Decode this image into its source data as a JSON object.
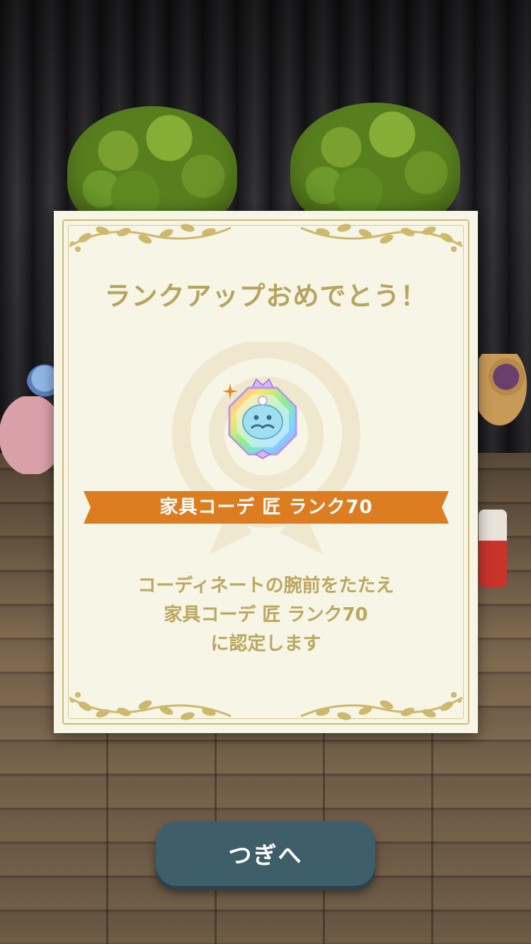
{
  "dialog": {
    "title": "ランクアップおめでとう！",
    "medal_icon": "rainbow-rank-medal-icon",
    "rank_label": "家具コーデ 匠 ランク70",
    "message_lines": [
      "コーディネートの腕前をたたえ",
      "家具コーデ 匠 ランク70",
      "に認定します"
    ]
  },
  "next_button": {
    "label": "つぎへ"
  },
  "colors": {
    "title": "#b7a45e",
    "ribbon": "#dc7d22",
    "button": "#3e5f6a",
    "dialog_bg": "#f6f5e6"
  }
}
